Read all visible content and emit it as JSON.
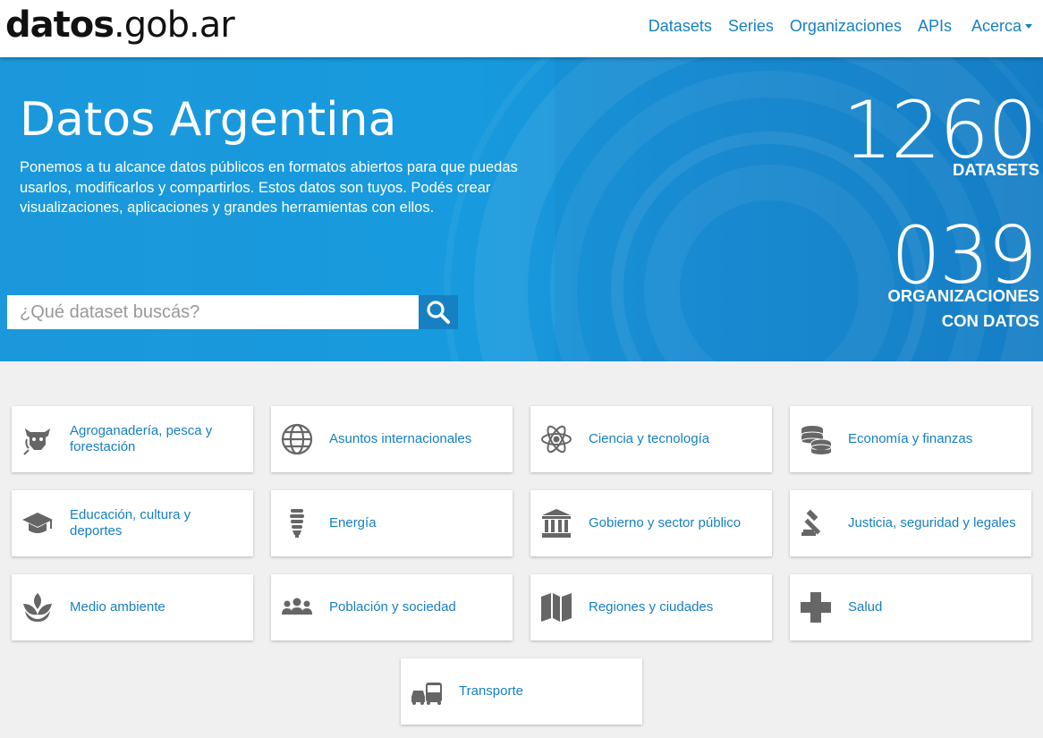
{
  "header": {
    "logo_bold": "datos",
    "logo_rest": ".gob.ar",
    "nav": [
      "Datasets",
      "Series",
      "Organizaciones",
      "APIs",
      "Acerca"
    ]
  },
  "hero": {
    "title": "Datos Argentina",
    "description": "Ponemos a tu alcance datos públicos en formatos abiertos para que puedas usarlos, modificarlos y compartirlos. Estos datos son tuyos. Podés crear visualizaciones, aplicaciones y grandes herramientas con ellos.",
    "search_placeholder": "¿Qué dataset buscás?",
    "stats": [
      {
        "number": "1260",
        "label_line1": "DATASETS",
        "label_line2": ""
      },
      {
        "number": "039",
        "label_line1": "ORGANIZACIONES",
        "label_line2": "CON DATOS"
      }
    ]
  },
  "categories": [
    {
      "label": "Agroganadería, pesca y forestación",
      "icon": "cow-wheat-icon"
    },
    {
      "label": "Asuntos internacionales",
      "icon": "globe-icon"
    },
    {
      "label": "Ciencia y tecnología",
      "icon": "atom-icon"
    },
    {
      "label": "Economía y finanzas",
      "icon": "coins-icon"
    },
    {
      "label": "Educación, cultura y deportes",
      "icon": "graduation-cap-icon"
    },
    {
      "label": "Energía",
      "icon": "lightbulb-icon"
    },
    {
      "label": "Gobierno y sector público",
      "icon": "government-building-icon"
    },
    {
      "label": "Justicia, seguridad y legales",
      "icon": "gavel-icon"
    },
    {
      "label": "Medio ambiente",
      "icon": "leaf-sprout-icon"
    },
    {
      "label": "Población y sociedad",
      "icon": "people-group-icon"
    },
    {
      "label": "Regiones y ciudades",
      "icon": "map-icon"
    },
    {
      "label": "Salud",
      "icon": "health-cross-icon"
    },
    {
      "label": "Transporte",
      "icon": "car-bus-icon"
    }
  ],
  "colors": {
    "accent": "#1780c2",
    "hero_bg": "#179ade",
    "icon_gray": "#666666"
  }
}
